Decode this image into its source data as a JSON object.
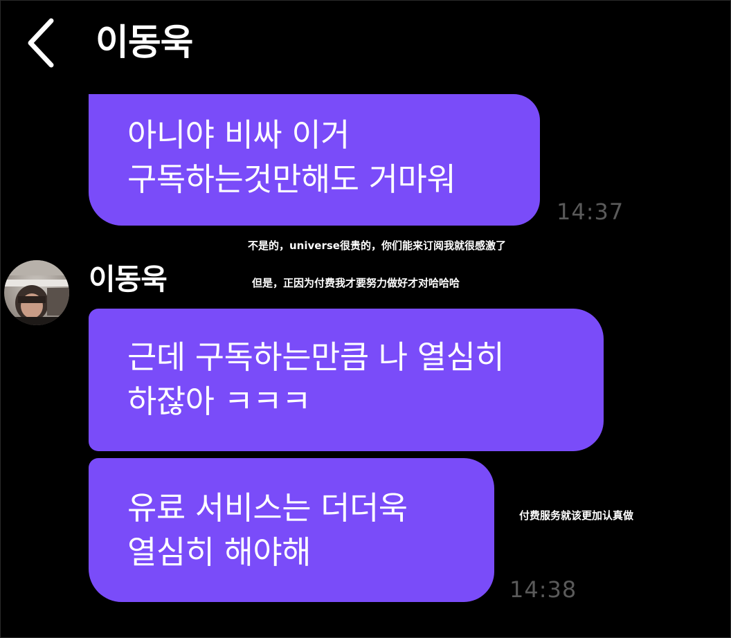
{
  "header": {
    "back_icon": "chevron-left-icon",
    "title": "이동욱"
  },
  "messages": [
    {
      "lines": [
        "아니야 비싸 이거",
        "구독하는것만해도 거마워"
      ],
      "time": "14:37"
    },
    {
      "sender": "이동욱",
      "avatar": "avatar-photo",
      "bubbles": [
        {
          "lines": [
            "근데 구독하는만큼 나 열심히",
            "하잖아 ㅋㅋㅋ"
          ]
        },
        {
          "lines": [
            "유료 서비스는 더더욱",
            "열심히 해야해"
          ]
        }
      ],
      "time": "14:38"
    }
  ],
  "captions": [
    "不是的，universe很贵的，你们能来订阅我就很感激了",
    "但是，正因为付费我才要努力做好才对哈哈哈",
    "付费服务就该更加认真做"
  ],
  "colors": {
    "background": "#000000",
    "bubble": "#7a4cf9",
    "timestamp": "#5a5a5a",
    "text": "#ffffff"
  }
}
